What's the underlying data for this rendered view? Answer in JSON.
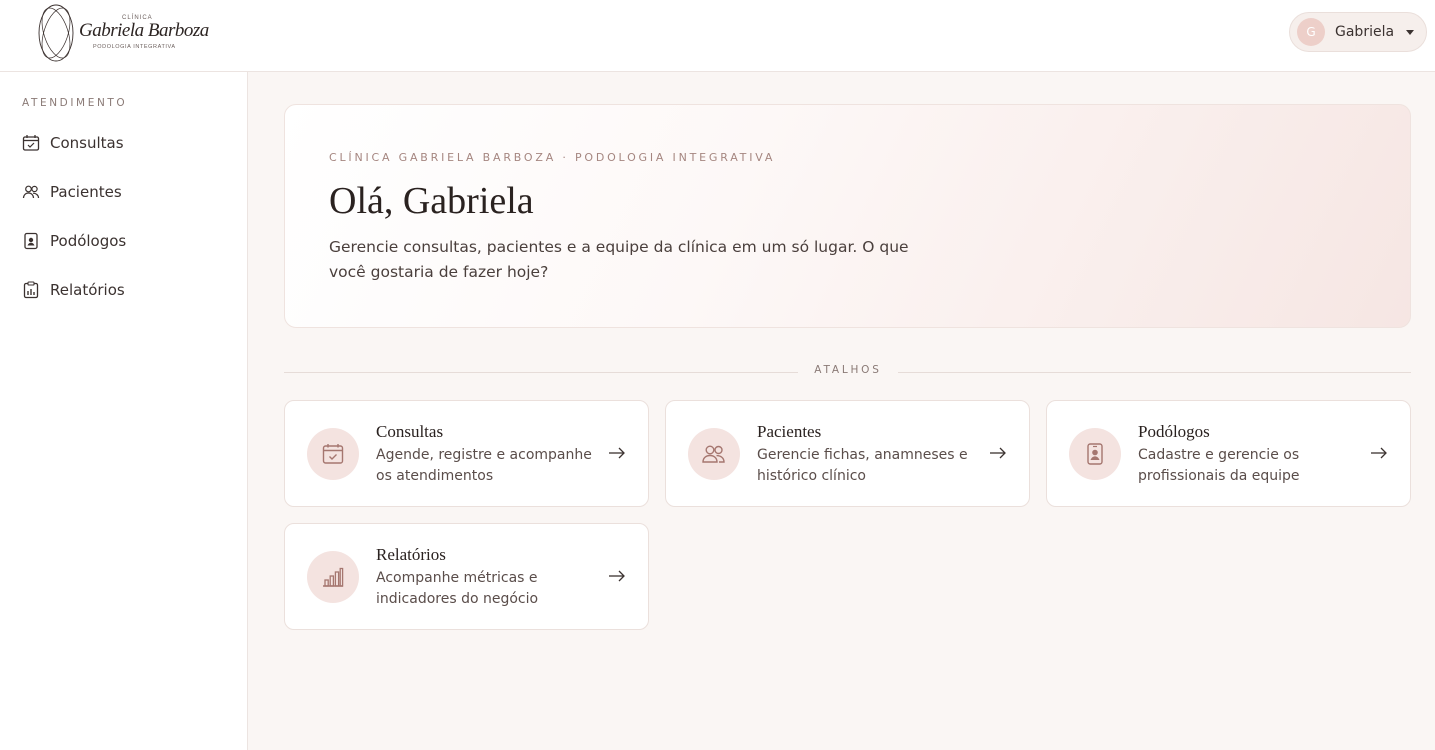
{
  "header": {
    "logo": {
      "clinica": "CLÍNICA",
      "brand": "Gabriela Barboza",
      "subtitle": "PODOLOGIA INTEGRATIVA"
    },
    "user": {
      "initial": "G",
      "name": "Gabriela"
    }
  },
  "sidebar": {
    "section_label": "ATENDIMENTO",
    "items": [
      {
        "label": "Consultas",
        "icon": "calendar-check-icon"
      },
      {
        "label": "Pacientes",
        "icon": "users-icon"
      },
      {
        "label": "Podólogos",
        "icon": "id-badge-icon"
      },
      {
        "label": "Relatórios",
        "icon": "report-icon"
      }
    ]
  },
  "hero": {
    "kicker": "CLÍNICA GABRIELA BARBOZA · PODOLOGIA INTEGRATIVA",
    "title": "Olá, Gabriela",
    "text": "Gerencie consultas, pacientes e a equipe da clínica em um só lugar. O que você gostaria de fazer hoje?"
  },
  "shortcuts": {
    "label": "ATALHOS",
    "cards": [
      {
        "title": "Consultas",
        "description": "Agende, registre e acompanhe os atendimentos",
        "icon": "calendar-check-icon"
      },
      {
        "title": "Pacientes",
        "description": "Gerencie fichas, anamneses e histórico clínico",
        "icon": "users-icon"
      },
      {
        "title": "Podólogos",
        "description": "Cadastre e gerencie os profissionais da equipe",
        "icon": "id-badge-icon"
      },
      {
        "title": "Relatórios",
        "description": "Acompanhe métricas e indicadores do negócio",
        "icon": "bar-chart-icon"
      }
    ]
  },
  "colors": {
    "accent": "#b98079",
    "badge_bg": "#f4e3e0",
    "main_bg": "#faf6f4"
  }
}
